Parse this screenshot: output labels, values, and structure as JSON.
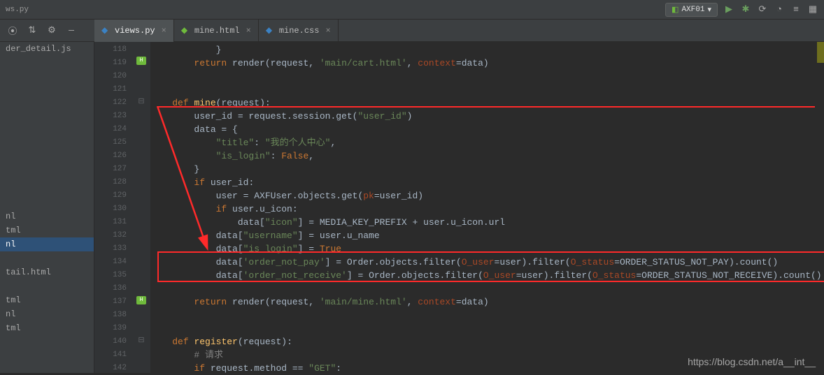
{
  "top_bar": {
    "path_fragment": "ws.py",
    "config_label": "AXF01",
    "dropdown_glyph": "▾"
  },
  "toolbar_icons": {
    "target": "⦿",
    "updown": "⇅",
    "gear": "⚙",
    "dash": "—",
    "play": "▶",
    "bug": "✱",
    "cov": "⟳",
    "prof": "◔",
    "stack": "≡",
    "grid": "▦"
  },
  "tabs": [
    {
      "label": "views.py",
      "icon_color": "#3b82c4",
      "active": true
    },
    {
      "label": "mine.html",
      "icon_color": "#6fba3c",
      "active": false
    },
    {
      "label": "mine.css",
      "icon_color": "#3b82c4",
      "active": false
    }
  ],
  "sidebar": {
    "items": [
      {
        "label": "der_detail.js",
        "sel": false
      },
      {
        "label": "",
        "sel": false
      },
      {
        "label": "",
        "sel": false
      },
      {
        "label": "",
        "sel": false
      },
      {
        "label": "",
        "sel": false
      },
      {
        "label": "",
        "sel": false
      },
      {
        "label": "",
        "sel": false
      },
      {
        "label": "",
        "sel": false
      },
      {
        "label": "",
        "sel": false
      },
      {
        "label": "",
        "sel": false
      },
      {
        "label": "",
        "sel": false
      },
      {
        "label": "",
        "sel": false
      },
      {
        "label": "nl",
        "sel": false
      },
      {
        "label": "tml",
        "sel": false
      },
      {
        "label": "nl",
        "sel": true
      },
      {
        "label": "",
        "sel": false
      },
      {
        "label": "tail.html",
        "sel": false
      },
      {
        "label": "",
        "sel": false
      },
      {
        "label": "tml",
        "sel": false
      },
      {
        "label": "nl",
        "sel": false
      },
      {
        "label": "tml",
        "sel": false
      }
    ]
  },
  "code": {
    "first_line_no": 118,
    "lines": [
      {
        "t": "            }"
      },
      {
        "t": "        return render(request, 'main/cart.html', context=data)"
      },
      {
        "t": ""
      },
      {
        "t": ""
      },
      {
        "t": "    def mine(request):"
      },
      {
        "t": "        user_id = request.session.get(\"user_id\")"
      },
      {
        "t": "        data = {"
      },
      {
        "t": "            \"title\": \"我的个人中心\","
      },
      {
        "t": "            \"is_login\": False,"
      },
      {
        "t": "        }"
      },
      {
        "t": "        if user_id:"
      },
      {
        "t": "            user = AXFUser.objects.get(pk=user_id)"
      },
      {
        "t": "            if user.u_icon:"
      },
      {
        "t": "                data[\"icon\"] = MEDIA_KEY_PREFIX + user.u_icon.url"
      },
      {
        "t": "            data[\"username\"] = user.u_name"
      },
      {
        "t": "            data[\"is_login\"] = True"
      },
      {
        "t": "            data['order_not_pay'] = Order.objects.filter(O_user=user).filter(O_status=ORDER_STATUS_NOT_PAY).count()"
      },
      {
        "t": "            data['order_not_receive'] = Order.objects.filter(O_user=user).filter(O_status=ORDER_STATUS_NOT_RECEIVE).count()"
      },
      {
        "t": ""
      },
      {
        "t": "        return render(request, 'main/mine.html', context=data)"
      },
      {
        "t": ""
      },
      {
        "t": ""
      },
      {
        "t": "    def register(request):"
      },
      {
        "t": "        # 请求"
      },
      {
        "t": "        if request.method == \"GET\":"
      }
    ]
  },
  "watermark": "https://blog.csdn.net/a__int__"
}
